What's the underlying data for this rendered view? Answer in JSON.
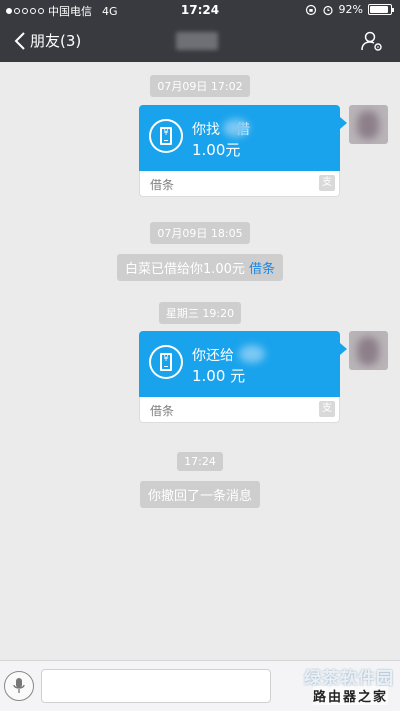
{
  "status_bar": {
    "carrier": "中国电信",
    "network": "4G",
    "time": "17:24",
    "battery": "92%",
    "battery_level": 0.92
  },
  "nav": {
    "back_label": "朋友(3)"
  },
  "chat": {
    "timestamps": [
      "07月09日 17:02",
      "07月09日 18:05",
      "星期三 19:20",
      "17:24"
    ],
    "card1": {
      "line1_a": "你找",
      "line1_b": "借",
      "amount": "1.00元",
      "footer": "借条"
    },
    "system1": {
      "text": "白菜已借给你1.00元",
      "link": "借条"
    },
    "card2": {
      "line1": "你还给",
      "amount": "1.00 元",
      "footer": "借条"
    },
    "system2": {
      "text": "你撤回了一条消息"
    }
  },
  "watermark": {
    "brand": "绿茶软件园",
    "sub": "路由器之家"
  },
  "colors": {
    "header": "#393a3f",
    "card_blue": "#19a3ec",
    "background": "#ebebeb",
    "link": "#1e88e5"
  },
  "icons": {
    "back": "chevron-left-icon",
    "profile": "user-settings-icon",
    "card": "receipt-icon",
    "mic": "microphone-icon"
  }
}
